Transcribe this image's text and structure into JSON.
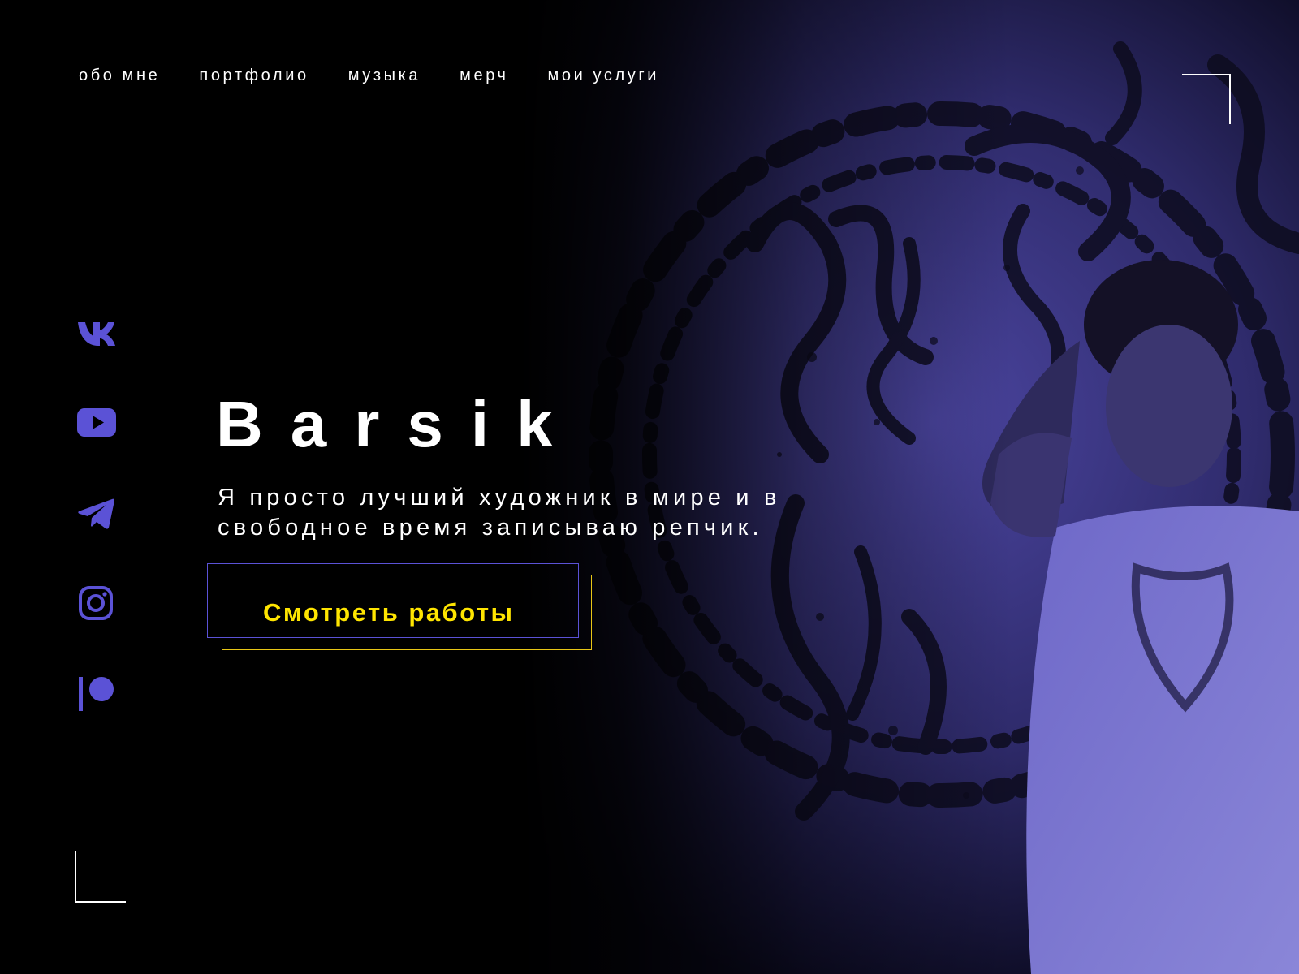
{
  "nav": {
    "items": [
      {
        "label": "обо мне"
      },
      {
        "label": "портфолио"
      },
      {
        "label": "музыка"
      },
      {
        "label": "мерч"
      },
      {
        "label": "мои услуги"
      }
    ]
  },
  "social": {
    "icons": [
      "vk-icon",
      "youtube-icon",
      "telegram-icon",
      "instagram-icon",
      "patreon-icon"
    ],
    "icon_color": "#5b52d6"
  },
  "hero": {
    "title": "Barsik",
    "subtitle": "Я просто лучший художник в мире и в свободное время записываю репчик.",
    "cta_label": "Смотреть работы"
  },
  "colors": {
    "background": "#000000",
    "accent_purple": "#5b52d6",
    "accent_yellow": "#ffe500",
    "text": "#ffffff"
  }
}
